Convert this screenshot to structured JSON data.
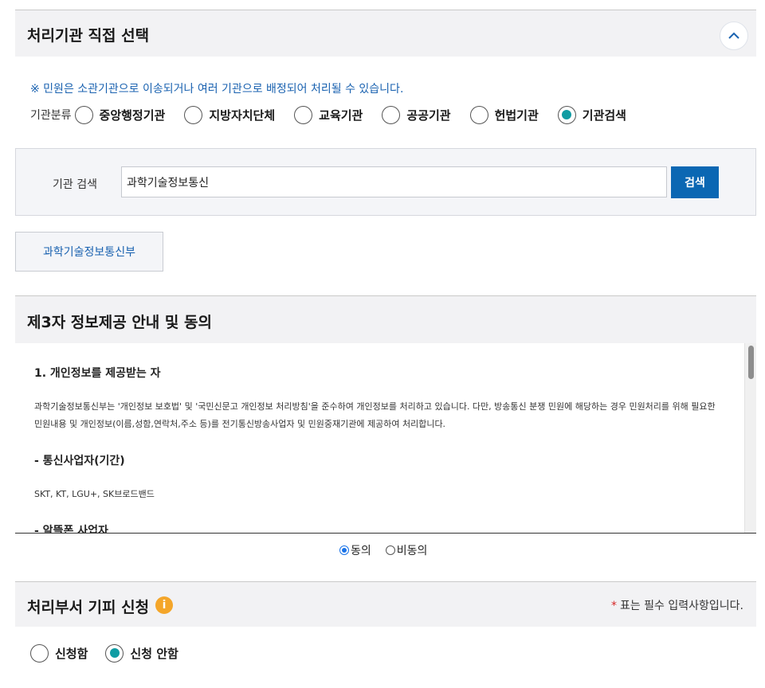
{
  "section_select_agency": {
    "title": "처리기관 직접 선택",
    "collapse_icon": "chevron-up-icon"
  },
  "notice": "※ 민원은 소관기관으로 이송되거나 여러 기관으로 배정되어 처리될 수 있습니다.",
  "classification": {
    "label": "기관분류",
    "options": [
      {
        "label": "중앙행정기관",
        "checked": false
      },
      {
        "label": "지방자치단체",
        "checked": false
      },
      {
        "label": "교육기관",
        "checked": false
      },
      {
        "label": "공공기관",
        "checked": false
      },
      {
        "label": "헌법기관",
        "checked": false
      },
      {
        "label": "기관검색",
        "checked": true
      }
    ]
  },
  "search": {
    "label": "기관 검색",
    "value": "과학기술정보통신",
    "button_label": "검색"
  },
  "result": {
    "label": "과학기술정보통신부"
  },
  "section_third_party": {
    "title": "제3자 정보제공 안내 및 동의",
    "heading1": "1. 개인정보를 제공받는 자",
    "para1_line1": "과학기술정보통신부는 '개인정보 보호법' 및 '국민신문고 개인정보 처리방침'을 준수하여 개인정보를 처리하고 있습니다. 다만, 방송통신 분쟁 민원에 해당하는 경우 민원처리를 위해 필요한",
    "para1_line2": "민원내용 및 개인정보(이름,성함,연락처,주소 등)를 전기통신방송사업자 및 민원중재기관에 제공하여 처리합니다.",
    "heading2": "- 통신사업자(기간)",
    "para2": "SKT, KT, LGU+, SK브로드밴드",
    "heading3": "- 알뜰폰 사업자"
  },
  "consent": {
    "agree": "동의",
    "disagree": "비동의",
    "agree_checked": true
  },
  "section_avoid": {
    "title": "처리부서 기피 신청",
    "info_icon": "info-icon",
    "required_star": "*",
    "required_note": "표는 필수 입력사항입니다.",
    "options": [
      {
        "label": "신청함",
        "checked": false
      },
      {
        "label": "신청 안함",
        "checked": true
      }
    ]
  }
}
